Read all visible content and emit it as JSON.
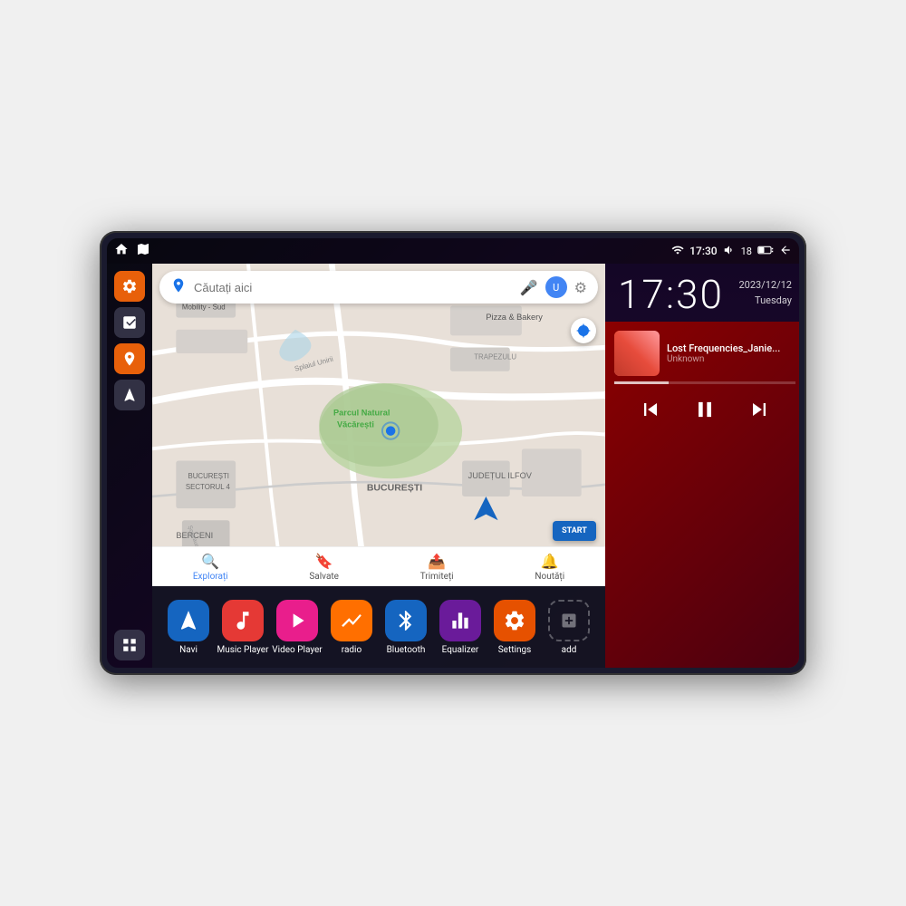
{
  "device": {
    "screen": {
      "status_bar": {
        "left_icons": [
          "home",
          "maps"
        ],
        "wifi_icon": "wifi",
        "time": "17:30",
        "volume_icon": "volume",
        "battery_level": "18",
        "battery_icon": "battery",
        "back_icon": "back"
      },
      "clock": {
        "time": "17:30",
        "date_line1": "2023/12/12",
        "date_line2": "Tuesday"
      },
      "music": {
        "title": "Lost Frequencies_Janie...",
        "artist": "Unknown",
        "progress": 30
      },
      "map": {
        "search_placeholder": "Căutați aici",
        "locations": [
          "AXIS Premium Mobility - Sud",
          "Parcul Natural Văcărești",
          "Pizza & Bakery",
          "TRAPEZULU",
          "BUCUREȘTI SECTORUL 4",
          "BUCUREȘTI",
          "JUDEȚUL ILFOV",
          "BERCENI"
        ],
        "nav_items": [
          {
            "label": "Explorați",
            "active": true
          },
          {
            "label": "Salvate",
            "active": false
          },
          {
            "label": "Trimiteți",
            "active": false
          },
          {
            "label": "Noutăți",
            "active": false
          }
        ]
      },
      "sidebar": {
        "items": [
          {
            "name": "settings",
            "color": "orange"
          },
          {
            "name": "layers",
            "color": "dark"
          },
          {
            "name": "location",
            "color": "orange"
          },
          {
            "name": "navigation",
            "color": "dark"
          }
        ],
        "bottom": {
          "name": "grid",
          "color": "dark"
        }
      },
      "apps": [
        {
          "id": "navi",
          "label": "Navi",
          "color": "#1565c0",
          "icon": "nav"
        },
        {
          "id": "music-player",
          "label": "Music Player",
          "color": "#e53935",
          "icon": "music"
        },
        {
          "id": "video-player",
          "label": "Video Player",
          "color": "#e91e8c",
          "icon": "video"
        },
        {
          "id": "radio",
          "label": "radio",
          "color": "#ff6f00",
          "icon": "radio"
        },
        {
          "id": "bluetooth",
          "label": "Bluetooth",
          "color": "#1565c0",
          "icon": "bluetooth"
        },
        {
          "id": "equalizer",
          "label": "Equalizer",
          "color": "#6a1b9a",
          "icon": "equalizer"
        },
        {
          "id": "settings",
          "label": "Settings",
          "color": "#e65100",
          "icon": "settings"
        },
        {
          "id": "add",
          "label": "add",
          "color": "transparent",
          "icon": "add"
        }
      ]
    }
  }
}
